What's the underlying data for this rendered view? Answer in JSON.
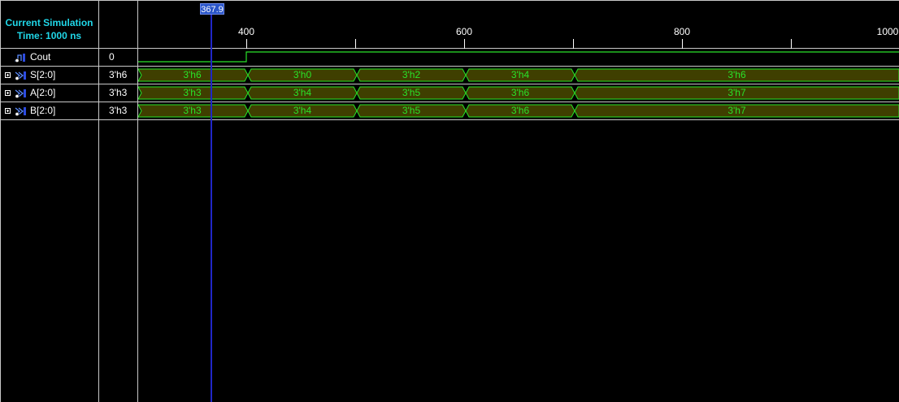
{
  "header": {
    "line1": "Current Simulation",
    "line2": "Time: 1000 ns"
  },
  "timeline": {
    "ticks": [
      "400",
      "600",
      "800",
      "1000"
    ]
  },
  "cursor": {
    "time_label": "367.9"
  },
  "colors": {
    "background": "#000000",
    "header_text": "#20d7e8",
    "wave": "#29e329",
    "bus_fill": "#3f3f00",
    "cursor": "#2027c8"
  },
  "signals": [
    {
      "name": "Cout",
      "value": "0",
      "kind": "bit",
      "icon": "signal-icon"
    },
    {
      "name": "S[2:0]",
      "value": "3'h6",
      "kind": "bus",
      "icon": "bus-icon",
      "segments": [
        {
          "label": "3'h6"
        },
        {
          "label": "3'h0"
        },
        {
          "label": "3'h2"
        },
        {
          "label": "3'h4"
        },
        {
          "label": "3'h6"
        }
      ]
    },
    {
      "name": "A[2:0]",
      "value": "3'h3",
      "kind": "bus",
      "icon": "bus-icon",
      "segments": [
        {
          "label": "3'h3"
        },
        {
          "label": "3'h4"
        },
        {
          "label": "3'h5"
        },
        {
          "label": "3'h6"
        },
        {
          "label": "3'h7"
        }
      ]
    },
    {
      "name": "B[2:0]",
      "value": "3'h3",
      "kind": "bus",
      "icon": "bus-icon",
      "segments": [
        {
          "label": "3'h3"
        },
        {
          "label": "3'h4"
        },
        {
          "label": "3'h5"
        },
        {
          "label": "3'h6"
        },
        {
          "label": "3'h7"
        }
      ]
    }
  ]
}
